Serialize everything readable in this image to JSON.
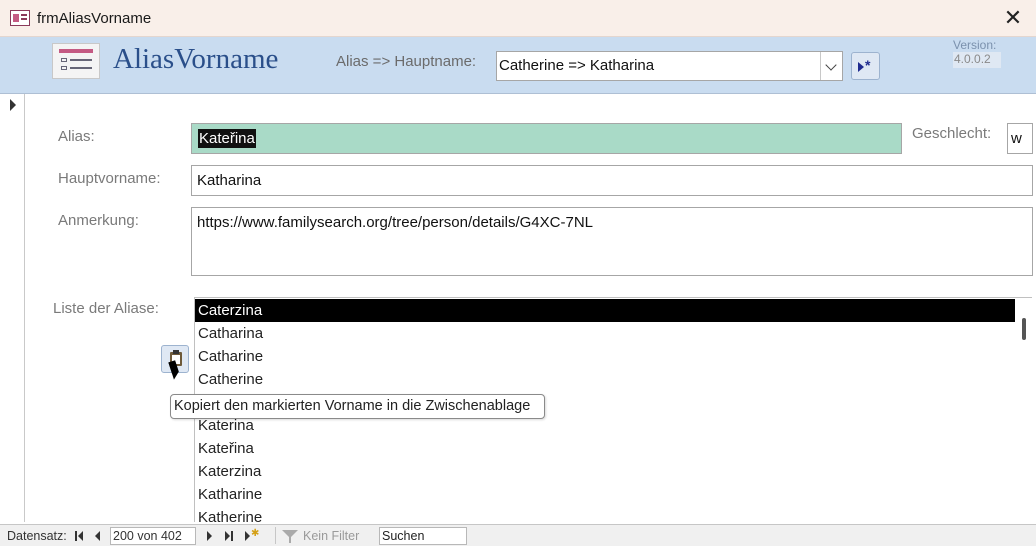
{
  "window": {
    "title": "frmAliasVorname"
  },
  "header": {
    "form_title": "AliasVorname",
    "alias_label": "Alias => Hauptname:",
    "combo_value": "Catherine => Katharina",
    "version_label": "Version:",
    "version_value": "4.0.0.2"
  },
  "form": {
    "alias_label": "Alias:",
    "alias_value": "Kateřina",
    "geschlecht_label": "Geschlecht:",
    "geschlecht_value": "w",
    "hauptvorname_label": "Hauptvorname:",
    "hauptvorname_value": "Katharina",
    "anmerkung_label": "Anmerkung:",
    "anmerkung_value": "https://www.familysearch.org/tree/person/details/G4XC-7NL",
    "liste_label": "Liste der Aliase:"
  },
  "list": {
    "items": [
      "Caterzina",
      "Catharina",
      "Catharine",
      "Catherine",
      "",
      "Katerina",
      "Kateřina",
      "Katerzina",
      "Katharine",
      "Katherine"
    ],
    "selected_index": 0
  },
  "tooltip": "Kopiert den markierten Vorname in die Zwischenablage",
  "navbar": {
    "label": "Datensatz:",
    "current": "200 von 402",
    "filter": "Kein Filter",
    "search": "Suchen"
  },
  "icons": {
    "app": "form-icon",
    "close": "close-icon",
    "new_record": "new-record-icon",
    "copy": "clipboard-icon",
    "filter": "filter-icon"
  }
}
